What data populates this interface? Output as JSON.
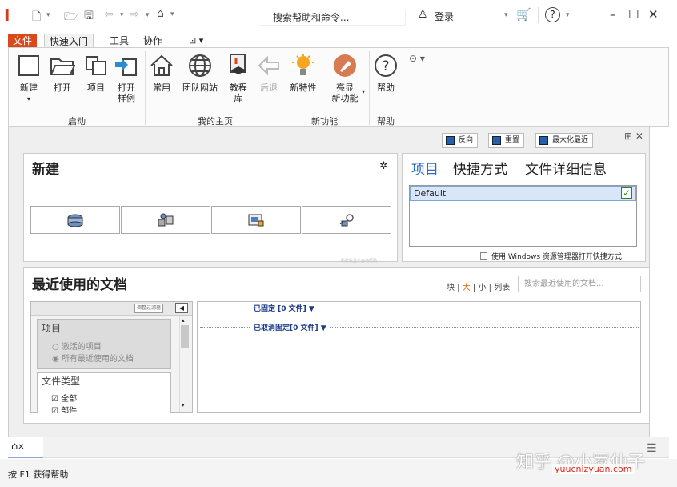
{
  "colors": {
    "accent": "#d84a1b",
    "link_orange": "#e2600a",
    "group_blue": "#1d3b87",
    "selection": "#d8e6f7"
  },
  "titlebar": {
    "search_placeholder": "搜索帮助和命令...",
    "login": "登录",
    "qa_icons": [
      "new-doc-icon",
      "open-folder-icon",
      "save-icon",
      "undo-icon",
      "redo-icon",
      "home-icon"
    ]
  },
  "menu": {
    "file": "文件",
    "quick": "快速入门",
    "tools": "工具",
    "collab": "协作"
  },
  "ribbon": {
    "new": "新建",
    "open": "打开",
    "project": "项目",
    "open_sample_1": "打开",
    "open_sample_2": "样例",
    "common": "常用",
    "team_site": "团队网站",
    "tutorial_1": "教程",
    "tutorial_2": "库",
    "back": "后退",
    "new_features": "新特性",
    "highlight_1": "亮显",
    "highlight_2": "新功能",
    "help": "帮助",
    "groups": {
      "start": "启动",
      "home": "我的主页",
      "new_feat": "新功能",
      "help": "帮助"
    }
  },
  "toolbar": {
    "reverse": "反向",
    "reset": "重置",
    "maximize_recent": "最大化最近"
  },
  "new_panel": {
    "title": "新建",
    "tiny": "新样板显示自动帮助"
  },
  "projects": {
    "tab_projects": "项目",
    "tab_shortcuts": "快捷方式",
    "tab_details": "文件详细信息",
    "default_item": "Default",
    "explorer_option": "使用 Windows 资源管理器打开快捷方式"
  },
  "recent": {
    "title": "最近使用的文档",
    "view_block": "块",
    "view_large": "大",
    "view_small": "小",
    "view_list": "列表",
    "search_placeholder": "搜索最近使用的文档...",
    "filter_button": "调整过滤器",
    "project_header": "项目",
    "opt_active": "激活的项目",
    "opt_all": "所有最近使用的文档",
    "filetype_header": "文件类型",
    "ft_all": "全部",
    "ft_part": "部件",
    "pinned": "已固定 [0 文件] ▼",
    "unpinned": "已取消固定[0 文件] ▼"
  },
  "status": {
    "help": "按 F1 获得帮助"
  },
  "watermark": {
    "text": "知乎 @小罗仙子",
    "url": "yuucnizyuan.com"
  }
}
